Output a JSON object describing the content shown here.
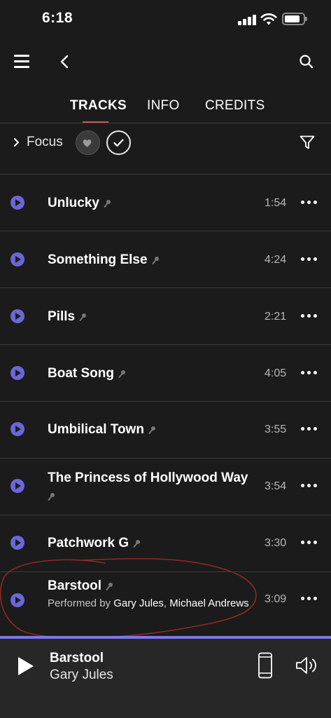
{
  "status_bar": {
    "time": "6:18"
  },
  "nav": {
    "menu_icon": "hamburger-icon",
    "back_icon": "chevron-left-icon",
    "search_icon": "search-icon"
  },
  "tabs": [
    {
      "label": "TRACKS",
      "active": true
    },
    {
      "label": "INFO",
      "active": false
    },
    {
      "label": "CREDITS",
      "active": false
    }
  ],
  "filter": {
    "focus_label": "Focus",
    "favorites_icon": "heart-icon",
    "check_icon": "check-icon",
    "filter_icon": "filter-funnel-icon"
  },
  "tracks": [
    {
      "title": "Unlucky",
      "duration": "1:54"
    },
    {
      "title": "Something Else",
      "duration": "4:24"
    },
    {
      "title": "Pills",
      "duration": "2:21"
    },
    {
      "title": "Boat Song",
      "duration": "4:05"
    },
    {
      "title": "Umbilical Town",
      "duration": "3:55"
    },
    {
      "title": "The Princess of Hollywood Way",
      "duration": "3:54"
    },
    {
      "title": "Patchwork G",
      "duration": "3:30"
    },
    {
      "title": "Barstool",
      "duration": "3:09",
      "performed_by_label": "Performed by ",
      "artist_1": "Gary Jules",
      "separator": ", ",
      "artist_2": "Michael Andrews"
    }
  ],
  "player": {
    "title": "Barstool",
    "artist": "Gary Jules",
    "progress": 1.0
  },
  "colors": {
    "accent": "#6a67d8",
    "tab_underline": "#c65a4c",
    "background": "#1b1b1b",
    "player_bg": "#272727",
    "annotation": "#8a2a22"
  }
}
